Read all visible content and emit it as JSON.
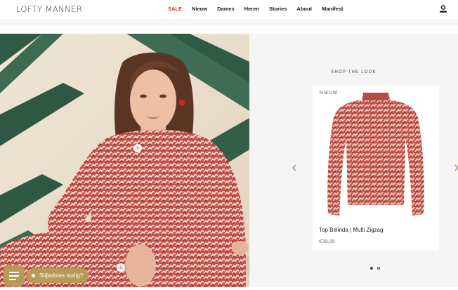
{
  "header": {
    "logo": "LOFTY MANNER",
    "nav": [
      {
        "label": "SALE"
      },
      {
        "label": "Nieuw"
      },
      {
        "label": "Dames"
      },
      {
        "label": "Heren"
      },
      {
        "label": "Stories"
      },
      {
        "label": "About"
      },
      {
        "label": "Manifest"
      }
    ],
    "account_icon": "user-icon"
  },
  "shop_the_look": {
    "title": "SHOP THE LOOK",
    "card": {
      "badge": "NIEUW",
      "name": "Top Belinda | Multi Zigzag",
      "price": "€39,95"
    },
    "prev_icon": "chevron-left-icon",
    "next_icon": "chevron-right-icon",
    "pagination": {
      "total": 2,
      "active": 1
    }
  },
  "hero": {
    "hotspots": [
      {
        "symbol": "+"
      },
      {
        "symbol": "+"
      }
    ]
  },
  "advice": {
    "label": "Stijladvies nodig?",
    "icon": "chat-lines-icon"
  },
  "colors": {
    "sale": "#d0322a",
    "accent_gold": "#b79a57",
    "panel_bg": "#f5f5f5"
  }
}
